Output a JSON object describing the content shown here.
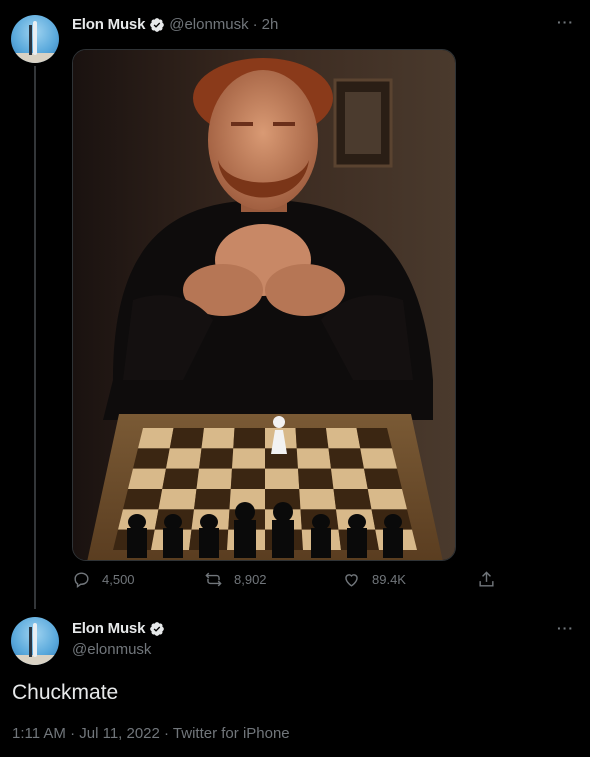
{
  "first_tweet": {
    "author_name": "Elon Musk",
    "author_handle": "@elonmusk",
    "time_separator": "·",
    "time": "2h",
    "more_label": "···",
    "media_alt": "Chuck Norris seated behind a chessboard",
    "actions": {
      "replies": "4,500",
      "retweets": "8,902",
      "likes": "89.4K"
    }
  },
  "second_tweet": {
    "author_name": "Elon Musk",
    "author_handle": "@elonmusk",
    "more_label": "···",
    "text": "Chuckmate",
    "meta": "1:11 AM · Jul 11, 2022 · Twitter for iPhone"
  },
  "colors": {
    "background": "#000000",
    "primary_text": "#e7e9ea",
    "secondary_text": "#71767b",
    "verified_badge": "#e7e9ea"
  },
  "icons": [
    "verified-icon",
    "reply-icon",
    "retweet-icon",
    "like-icon",
    "share-icon",
    "more-icon"
  ]
}
